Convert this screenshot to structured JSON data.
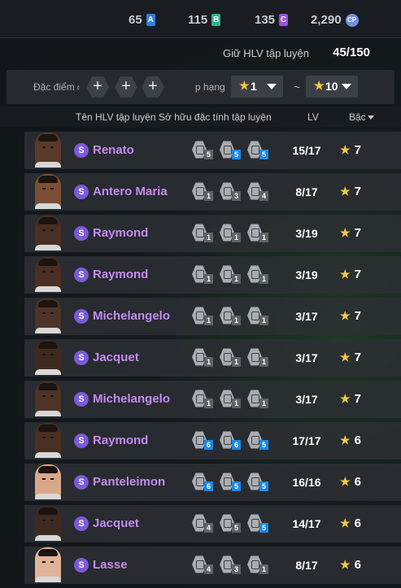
{
  "currency": [
    {
      "value": "65",
      "chip": "A",
      "color": "#2f7fe0"
    },
    {
      "value": "115",
      "chip": "B",
      "color": "#2fb38a"
    },
    {
      "value": "135",
      "chip": "C",
      "color": "#9b4fe0"
    },
    {
      "value": "2,290",
      "chip": "CP",
      "color": "#6e8fe8"
    }
  ],
  "hold": {
    "label": "Giữ HLV tập luyện",
    "value": "45/150"
  },
  "filter": {
    "traits_label": "Đặc điểm đ",
    "add_symbol": "+",
    "rank_label": "p hạng",
    "from": "1",
    "to": "10",
    "separator": "~",
    "star": "★"
  },
  "table": {
    "headers": {
      "name": "Tên HLV tập luyện",
      "traits": "Sở hữu đặc tính tập luyện",
      "lv": "LV",
      "rank": "Bậc"
    },
    "rows": [
      {
        "name": "Renato",
        "grade": "S",
        "lv": "15/17",
        "rank": "7",
        "skin": "#5a3a2a",
        "skills": [
          {
            "lvl": "5",
            "blue": false
          },
          {
            "lvl": "5",
            "blue": true
          },
          {
            "lvl": "5",
            "blue": true
          }
        ]
      },
      {
        "name": "Antero Maria",
        "grade": "S",
        "lv": "8/17",
        "rank": "7",
        "skin": "#7a4f36",
        "skills": [
          {
            "lvl": "1",
            "blue": false
          },
          {
            "lvl": "3",
            "blue": false
          },
          {
            "lvl": "4",
            "blue": false
          }
        ]
      },
      {
        "name": "Raymond",
        "grade": "S",
        "lv": "3/19",
        "rank": "7",
        "skin": "#4a2f22",
        "skills": [
          {
            "lvl": "1",
            "blue": false
          },
          {
            "lvl": "1",
            "blue": false
          },
          {
            "lvl": "1",
            "blue": false
          }
        ]
      },
      {
        "name": "Raymond",
        "grade": "S",
        "lv": "3/19",
        "rank": "7",
        "skin": "#4a2f22",
        "skills": [
          {
            "lvl": "1",
            "blue": false
          },
          {
            "lvl": "1",
            "blue": false
          },
          {
            "lvl": "1",
            "blue": false
          }
        ]
      },
      {
        "name": "Michelangelo",
        "grade": "S",
        "lv": "3/17",
        "rank": "7",
        "skin": "#4e3426",
        "skills": [
          {
            "lvl": "1",
            "blue": false
          },
          {
            "lvl": "1",
            "blue": false
          },
          {
            "lvl": "1",
            "blue": false
          }
        ]
      },
      {
        "name": "Jacquet",
        "grade": "S",
        "lv": "3/17",
        "rank": "7",
        "skin": "#3f2a20",
        "skills": [
          {
            "lvl": "1",
            "blue": false
          },
          {
            "lvl": "1",
            "blue": false
          },
          {
            "lvl": "1",
            "blue": false
          }
        ]
      },
      {
        "name": "Michelangelo",
        "grade": "S",
        "lv": "3/17",
        "rank": "7",
        "skin": "#4e3426",
        "skills": [
          {
            "lvl": "1",
            "blue": false
          },
          {
            "lvl": "1",
            "blue": false
          },
          {
            "lvl": "1",
            "blue": false
          }
        ]
      },
      {
        "name": "Raymond",
        "grade": "S",
        "lv": "17/17",
        "rank": "6",
        "skin": "#4a2f22",
        "skills": [
          {
            "lvl": "6",
            "blue": true
          },
          {
            "lvl": "6",
            "blue": true
          },
          {
            "lvl": "5",
            "blue": true
          }
        ]
      },
      {
        "name": "Panteleimon",
        "grade": "S",
        "lv": "16/16",
        "rank": "6",
        "skin": "#d9a88a",
        "skills": [
          {
            "lvl": "6",
            "blue": true
          },
          {
            "lvl": "5",
            "blue": true
          },
          {
            "lvl": "5",
            "blue": true
          }
        ]
      },
      {
        "name": "Jacquet",
        "grade": "S",
        "lv": "14/17",
        "rank": "6",
        "skin": "#3f2a20",
        "skills": [
          {
            "lvl": "4",
            "blue": false
          },
          {
            "lvl": "5",
            "blue": false
          },
          {
            "lvl": "5",
            "blue": true
          }
        ]
      },
      {
        "name": "Lasse",
        "grade": "S",
        "lv": "8/17",
        "rank": "6",
        "skin": "#e0b49a",
        "skills": [
          {
            "lvl": "4",
            "blue": false
          },
          {
            "lvl": "3",
            "blue": false
          },
          {
            "lvl": "1",
            "blue": false
          }
        ]
      }
    ]
  }
}
